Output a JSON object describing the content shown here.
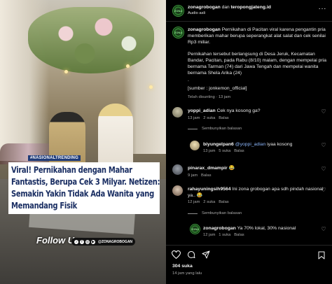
{
  "post_image": {
    "tag": "#NASIONALTRENDING",
    "headline": "Viral! Pernikahan dengan Mahar Fantastis, Berupa Cek 3 Milyar. Netizen: Semakin Yakin Tidak Ada Wanita yang Memandang Fisik",
    "follow_label": "Follow Us:",
    "social_handle": "@ZONAGROBOGAN"
  },
  "header": {
    "account": "zonagrobogan",
    "connector": "dan",
    "collaborator": "teropongjateng.id",
    "audio": "Audio asli",
    "avatar_text": "ZONA"
  },
  "caption": {
    "username": "zonagrobogan",
    "line1": "Pernikahan di Pacitan viral karena pengantin pria memberikan mahar berupa seperangkat alat salat dan cek senilai Rp3 miliar.",
    "line2": "Pernikahan tersebut berlangsung di Desa Jeruk, Kecamatan Bandar, Pacitan, pada Rabu (8/10) malam, dengan mempelai pria bernama Tarman (74) dari Jawa Tengah dan mempelai wanita bernama Shela Arika (24)",
    "line3": ".",
    "line4": "[sumber : jonkemon_official]",
    "meta": "Telah disunting · 13 jam"
  },
  "comments": [
    {
      "username": "yoppi_adian",
      "text": "Cek nya kosong ga?",
      "time": "13 jam",
      "likes": "2 suka",
      "reply": "Balas",
      "hide_replies": "Sembunyikan balasan"
    },
    {
      "username": "biyungelpan6",
      "mention": "@yoppi_adian",
      "text": "iyaa kosong",
      "time": "13 jam",
      "likes": "5 suka",
      "reply": "Balas"
    },
    {
      "username": "pinarax_dmampir",
      "text": "😂",
      "time": "9 jam",
      "reply": "Balas"
    },
    {
      "username": "rahayuningsih9564",
      "text": "Ini zona grobogan apa sdh pindah nasional ya.. 😂",
      "time": "12 jam",
      "likes": "2 suka",
      "reply": "Balas",
      "hide_replies": "Sembunyikan balasan"
    },
    {
      "username": "zonagrobogan",
      "text": "Ya 70% lokal, 30% nasional",
      "time": "12 jam",
      "likes": "1 suka",
      "reply": "Balas"
    }
  ],
  "footer": {
    "likes": "304 suka",
    "time": "14 jam yang lalu"
  },
  "icons": {
    "more": "more-icon",
    "like": "heart-icon",
    "comment": "comment-icon",
    "share": "share-icon",
    "save": "bookmark-icon"
  }
}
